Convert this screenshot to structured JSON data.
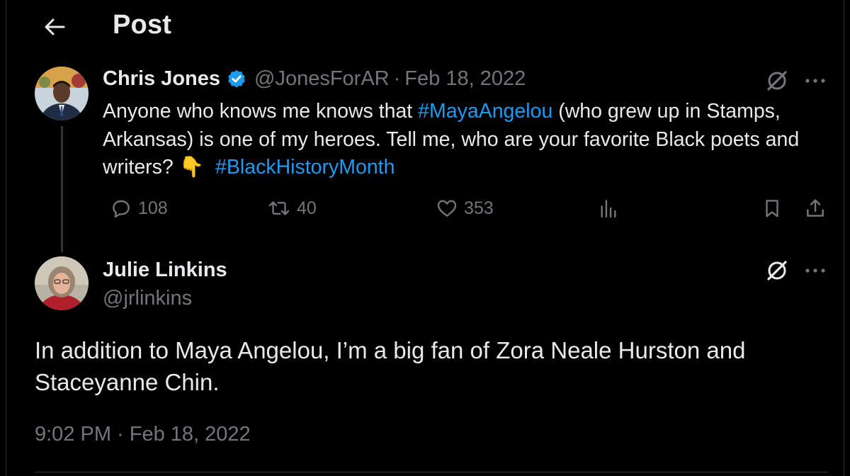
{
  "header": {
    "title": "Post",
    "back_icon": "arrow-left-icon"
  },
  "original_post": {
    "author_name": "Chris Jones",
    "verified": true,
    "handle": "@JonesForAR",
    "separator": "·",
    "date": "Feb 18, 2022",
    "text_1": "Anyone who knows me knows that ",
    "hashtag_1": "#MayaAngelou",
    "text_2": " (who grew up in Stamps, Arkansas) is one of my heroes. Tell me, who are your favorite Black poets and writers? ",
    "emoji": "👇",
    "text_3": "  ",
    "hashtag_2": "#BlackHistoryMonth",
    "stats": {
      "replies": "108",
      "reposts": "40",
      "likes": "353"
    }
  },
  "reply_post": {
    "author_name": "Julie Linkins",
    "handle": "@jrlinkins",
    "text": "In addition to Maya Angelou, I’m a big fan of Zora Neale Hurston and Staceyanne Chin.",
    "timestamp": "9:02 PM · Feb 18, 2022"
  },
  "colors": {
    "background": "#000000",
    "text": "#e7e9ea",
    "muted": "#71767b",
    "accent": "#1d9bf0",
    "divider": "#2f3336"
  }
}
